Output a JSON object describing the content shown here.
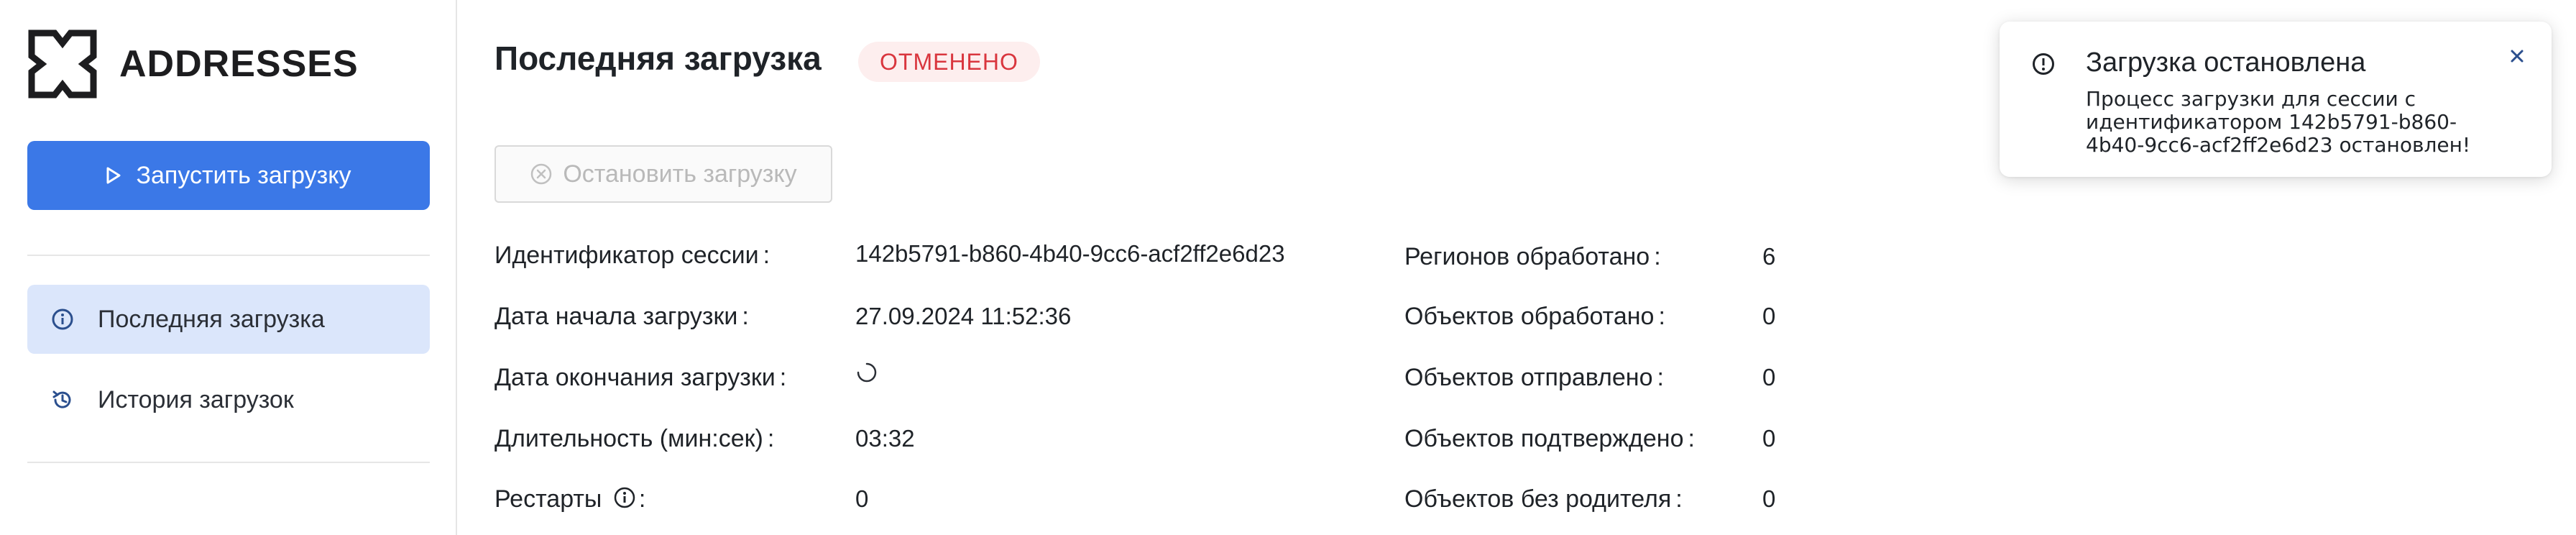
{
  "app": {
    "logo_text": "ADDRESSES"
  },
  "sidebar": {
    "start_button_label": "Запустить загрузку",
    "items": [
      {
        "label": "Последняя загрузка",
        "icon": "info-circle-icon",
        "active": true
      },
      {
        "label": "История загрузок",
        "icon": "history-icon",
        "active": false
      }
    ]
  },
  "main": {
    "title": "Последняя загрузка",
    "status": "ОТМЕНЕНО",
    "stop_button_label": "Остановить загрузку",
    "left_rows": [
      {
        "label": "Идентификатор сессии",
        "value": "142b5791-b860-4b40-9cc6-acf2ff2e6d23"
      },
      {
        "label": "Дата начала загрузки",
        "value": "27.09.2024 11:52:36"
      },
      {
        "label": "Дата окончания загрузки",
        "value": ""
      },
      {
        "label": "Длительность (мин:сек)",
        "value": "03:32"
      },
      {
        "label": "Рестарты",
        "value": "0"
      }
    ],
    "right_rows": [
      {
        "label": "Регионов обработано",
        "value": "6"
      },
      {
        "label": "Объектов обработано",
        "value": "0"
      },
      {
        "label": "Объектов отправлено",
        "value": "0"
      },
      {
        "label": "Объектов подтверждено",
        "value": "0"
      },
      {
        "label": "Объектов без родителя",
        "value": "0"
      }
    ],
    "colon": ":"
  },
  "toast": {
    "title": "Загрузка остановлена",
    "message": "Процесс загрузки для сессии с идентификатором 142b5791-b860-4b40-9cc6-acf2ff2e6d23 остановлен!"
  },
  "colors": {
    "accent": "#3b78e7",
    "active_nav_bg": "#dbe6fb",
    "status_bg": "#fdeeee",
    "status_text": "#d9363e"
  }
}
